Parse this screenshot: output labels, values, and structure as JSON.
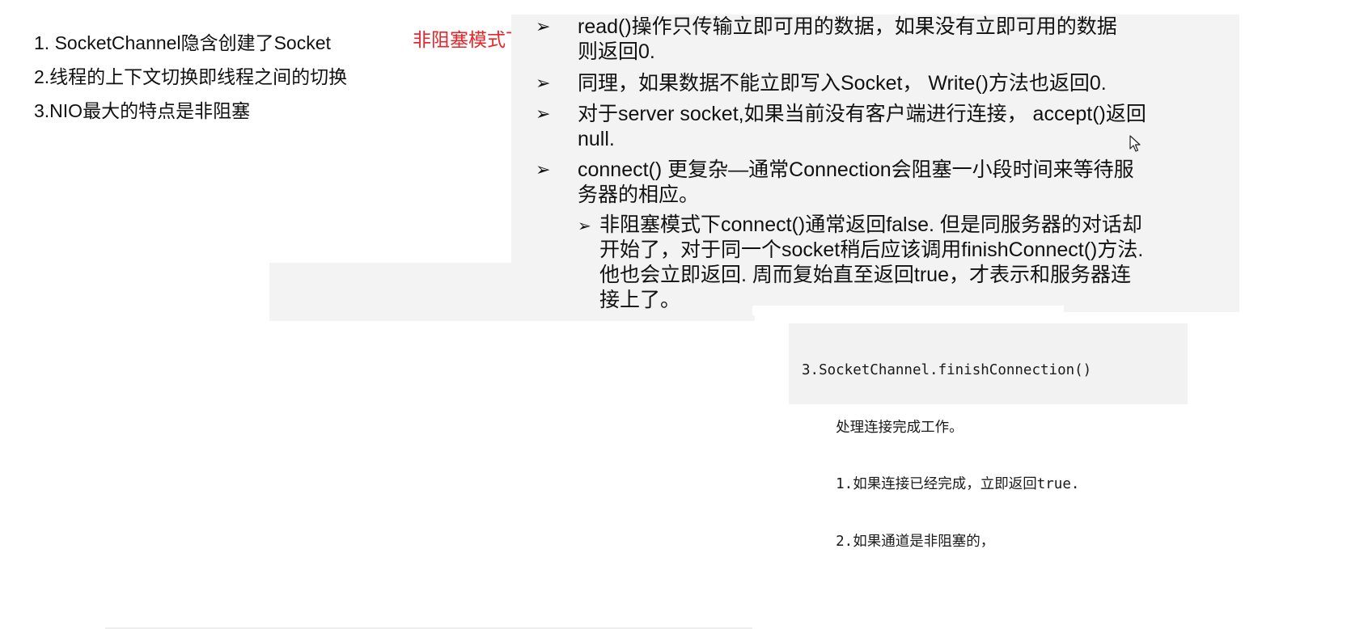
{
  "notes": [
    "1. SocketChannel隐含创建了Socket",
    "2.线程的上下文切换即线程之间的切换",
    "3.NIO最大的特点是非阻塞"
  ],
  "red_label": "非阻塞模式下",
  "bullets": [
    {
      "lines": [
        "read()操作只传输立即可用的数据，如果没有立即可用的数据",
        "则返回0."
      ]
    },
    {
      "lines": [
        "同理，如果数据不能立即写入Socket， Write()方法也返回0."
      ]
    },
    {
      "lines": [
        "对于server socket,如果当前没有客户端进行连接，  accept()返回",
        "null."
      ]
    },
    {
      "lines": [
        "connect() 更复杂—通常Connection会阻塞一小段时间来等待服",
        "务器的相应。"
      ]
    }
  ],
  "sub_bullet": {
    "lines": [
      "非阻塞模式下connect()通常返回false.  但是同服务器的对话却",
      "开始了，对于同一个socket稍后应该调用finishConnect()方法.",
      "他也会立即返回. 周而复始直至返回true，才表示和服务器连",
      "接上了。"
    ]
  },
  "code_lines": [
    "3.SocketChannel.finishConnection()",
    "    处理连接完成工作。",
    "    1.如果连接已经完成，立即返回true.",
    "    2.如果通道是非阻塞的，"
  ],
  "bullet_glyph": "➢",
  "colors": {
    "red_label": "#e8262a",
    "panel_bg": "#f3f3f3",
    "code_bg": "#f2f2f2"
  },
  "icons": [
    "bullet-arrow-icon",
    "mouse-cursor-icon"
  ]
}
